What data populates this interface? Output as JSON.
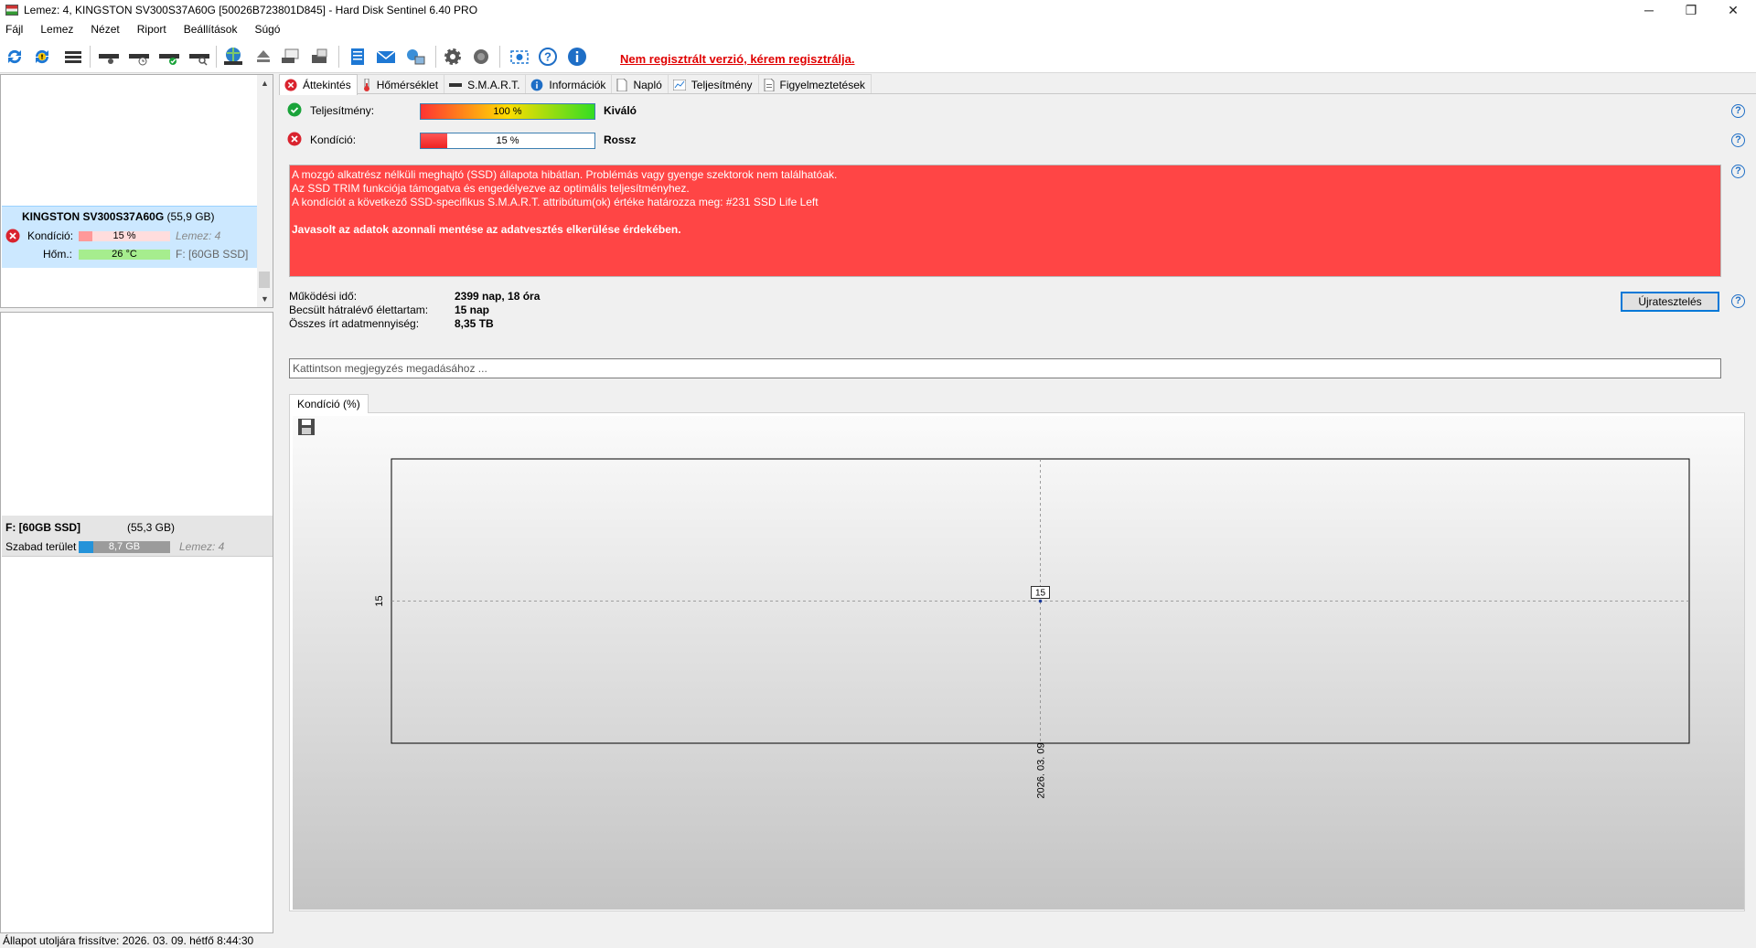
{
  "window": {
    "title": "Lemez: 4, KINGSTON SV300S37A60G [50026B723801D845]  -  Hard Disk Sentinel 6.40 PRO",
    "minimize": "─",
    "maximize": "❐",
    "close": "✕"
  },
  "menu": [
    "Fájl",
    "Lemez",
    "Nézet",
    "Riport",
    "Beállítások",
    "Súgó"
  ],
  "toolbar": {
    "icons": [
      "refresh-icon",
      "refresh-alert-icon",
      "disk-list-icon",
      "disk-surface-icon",
      "disk-time-icon",
      "disk-check-icon",
      "disk-search-icon",
      "globe-disk-icon",
      "eject-icon",
      "network-disk-icon",
      "disk-write-icon",
      "report-icon",
      "mail-icon",
      "network-icon",
      "settings-icon",
      "sound-icon",
      "screenshot-icon",
      "help-icon",
      "info-icon"
    ],
    "register_text": "Nem regisztrált verzió, kérem regisztrálja."
  },
  "disk_list": {
    "disk_name": "KINGSTON SV300S37A60G",
    "disk_size": "(55,9 GB)",
    "condition_label": "Kondíció:",
    "condition_value": "15 %",
    "condition_pct": 15,
    "disk_index": "Lemez: 4",
    "temp_label": "Hőm.:",
    "temp_value": "26 °C",
    "volume": "F: [60GB SSD]"
  },
  "partition_list": {
    "name": "F: [60GB SSD]",
    "size": "(55,3 GB)",
    "free_label": "Szabad terület",
    "free_value": "8,7 GB",
    "free_fraction": 0.16,
    "disk_index": "Lemez: 4"
  },
  "tabs": [
    "Áttekintés",
    "Hőmérséklet",
    "S.M.A.R.T.",
    "Információk",
    "Napló",
    "Teljesítmény",
    "Figyelmeztetések"
  ],
  "overview": {
    "performance_label": "Teljesítmény:",
    "performance_value": "100 %",
    "performance_pct": 100,
    "performance_rating": "Kiváló",
    "condition_label": "Kondíció:",
    "condition_value": "15 %",
    "condition_pct": 15,
    "condition_rating": "Rossz",
    "alert_lines": [
      "A mozgó alkatrész nélküli meghajtó (SSD) állapota hibátlan. Problémás vagy gyenge szektorok nem találhatóak.",
      "Az SSD TRIM funkciója támogatva és engedélyezve az optimális teljesítményhez.",
      "A kondíciót a következő SSD-specifikus S.M.A.R.T. attribútum(ok) értéke határozza meg:  #231 SSD Life Left"
    ],
    "alert_recommendation": "Javasolt az adatok azonnali mentése az adatvesztés elkerülése érdekében.",
    "uptime_label": "Működési idő:",
    "uptime_value": "2399 nap, 18 óra",
    "remaining_label": "Becsült hátralévő élettartam:",
    "remaining_value": "15 nap",
    "written_label": "Összes írt adatmennyiség:",
    "written_value": "8,35 TB",
    "retest_button": "Újratesztelés",
    "comment_placeholder": "Kattintson megjegyzés megadásához ...",
    "chart_tab": "Kondíció  (%)"
  },
  "chart_data": {
    "type": "line",
    "series": [
      {
        "values": [
          15
        ]
      }
    ],
    "x": [
      "2026. 03. 09"
    ],
    "y_ticks": [
      "15"
    ],
    "data_labels": [
      "15"
    ],
    "grid": true
  },
  "status": "Állapot utoljára frissítve: 2026. 03. 09. hétfő 8:44:30"
}
